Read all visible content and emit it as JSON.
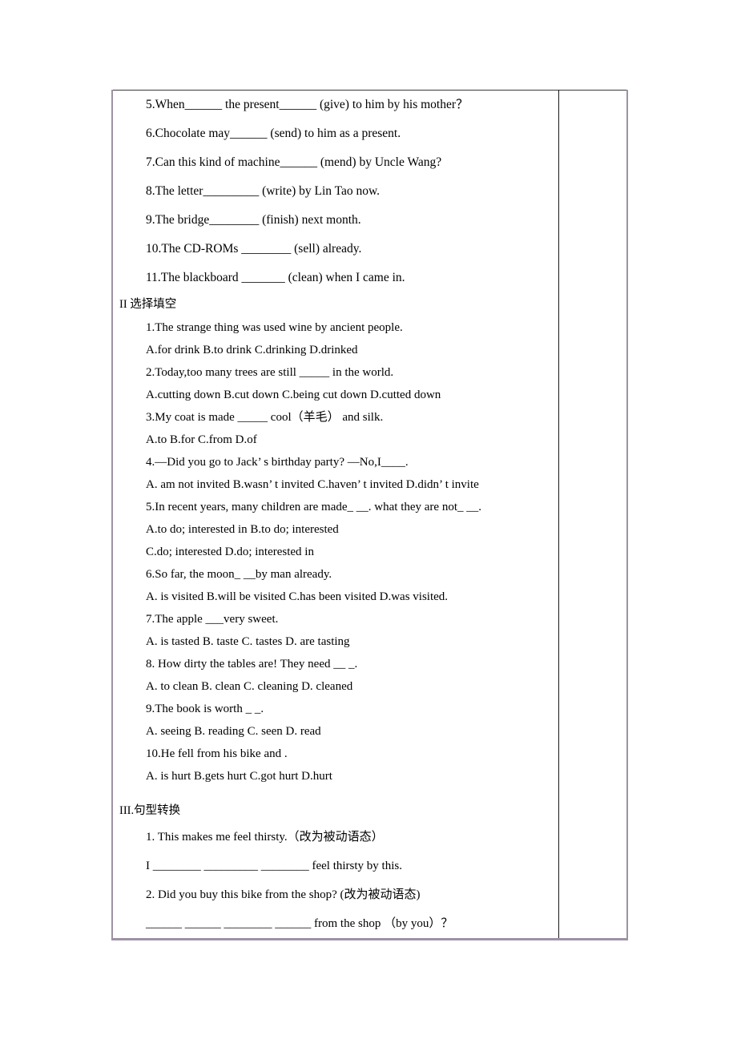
{
  "document": {
    "type": "worksheet",
    "language": "zh-CN/en",
    "notes_column_content": ""
  },
  "section_fill_blanks": {
    "items": [
      "5.When______ the present______ (give) to him by his mother？",
      "6.Chocolate may______ (send) to him as a present.",
      "7.Can this kind of machine______ (mend) by Uncle Wang?",
      "8.The letter_________ (write) by Lin Tao now.",
      "9.The bridge________ (finish) next month.",
      "10.The CD-ROMs ________ (sell) already.",
      "11.The blackboard _______ (clean) when I came in."
    ]
  },
  "section_multiple_choice": {
    "heading": "II 选择填空",
    "questions": [
      {
        "stem": "1.The strange thing was used wine by ancient people.",
        "options": "A.for drink    B.to drink       C.drinking       D.drinked"
      },
      {
        "stem": "2.Today,too many trees are still _____ in the world.",
        "options": "A.cutting down    B.cut down    C.being cut down   D.cutted down"
      },
      {
        "stem": "3.My coat is made _____ cool（羊毛） and silk.",
        "options": "A.to       B.for       C.from        D.of"
      },
      {
        "stem": "4.—Did you go to Jack’ s birthday party?        —No,I____.",
        "options": "A. am not invited   B.wasn’ t invited   C.haven’ t invited   D.didn’ t invite"
      },
      {
        "stem": "5.In recent years, many children are made_ __.        what they are not_ __.",
        "options": "A.to do; interested in      B.to do; interested",
        "options2": "C.do; interested             D.do; interested in"
      },
      {
        "stem": "6.So far, the moon_  __by man already.",
        "options": " A. is visited     B.will be visited    C.has been visited  D.was visited."
      },
      {
        "stem": "7.The apple   ___very sweet.",
        "options": "A. is tasted      B. taste      C. tastes     D. are tasting"
      },
      {
        "stem": "8. How dirty the tables are! They need __    _.",
        "options": "A. to clean     B. clean     C. cleaning      D. cleaned"
      },
      {
        "stem": "9.The book is worth _      _.",
        "options": "A. seeing      B. reading      C. seen       D. read"
      },
      {
        "stem": "10.He fell from his bike and           .",
        "options": "A. is hurt      B.gets hurt      C.got hurt       D.hurt"
      }
    ]
  },
  "section_sentence_transformation": {
    "heading": "III.句型转换",
    "items": [
      "1. This makes me feel thirsty.（改为被动语态）",
      "I ________ _________  ________ feel thirsty by this.",
      "2. Did you buy this bike from the shop? (改为被动语态)",
      "______ ______ ________ ______ from the shop  （by you）？"
    ]
  }
}
